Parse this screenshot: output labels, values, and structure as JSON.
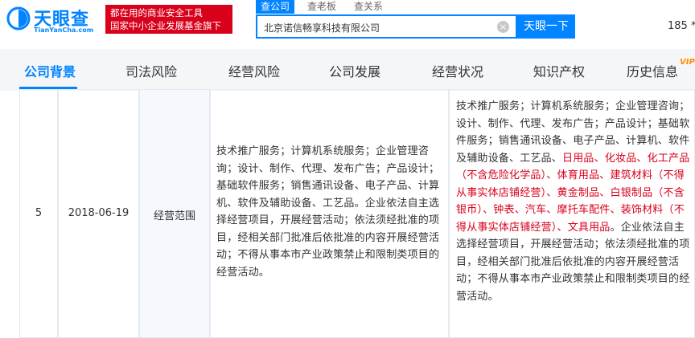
{
  "header": {
    "logo_title": "天眼查",
    "logo_subtitle": "TianYanCha.com",
    "slogan_line1": "都在用的商业安全工具",
    "slogan_line2": "国家中小企业发展基金旗下",
    "search_tabs": [
      "查公司",
      "查老板",
      "查关系"
    ],
    "search_value": "北京诺信畅享科技有限公司",
    "search_button": "天眼一下",
    "clear_icon": "×",
    "phone_partial": "185 *"
  },
  "nav": {
    "items": [
      "公司背景",
      "司法风险",
      "经营风险",
      "公司发展",
      "经营状况",
      "知识产权",
      "历史信息"
    ],
    "vip_badge": "VIP"
  },
  "row": {
    "index": "5",
    "date": "2018-06-19",
    "field": "经营范围",
    "before": "技术推广服务；计算机系统服务；企业管理咨询；设计、制作、代理、发布广告；产品设计；基础软件服务；销售通讯设备、电子产品、计算机、软件及辅助设备、工艺品。企业依法自主选择经营项目，开展经营活动；依法须经批准的项目，经相关部门批准后依批准的内容开展经营活动；不得从事本市产业政策禁止和限制类项目的经营活动。",
    "after_part1": "技术推广服务；计算机系统服务；企业管理咨询；设计、制作、代理、发布广告；产品设计；基础软件服务；销售通讯设备、电子产品、计算机、软件及辅助设备、工艺品、",
    "after_highlight": "日用品、化妆品、化工产品（不含危险化学品）、体育用品、建筑材料（不得从事实体店铺经营）、黄金制品、白银制品（不含银币）、钟表、汽车、摩托车配件、装饰材料（不得从事实体店铺经营）、文具用品",
    "after_part2": "。企业依法自主选择经营项目，开展经营活动；依法须经批准的项目，经相关部门批准后依批准的内容开展经营活动；不得从事本市产业政策禁止和限制类项目的经营活动。"
  },
  "colors": {
    "brand": "#0084ff",
    "slogan_bg": "#d9001b",
    "highlight": "#d9001b"
  }
}
